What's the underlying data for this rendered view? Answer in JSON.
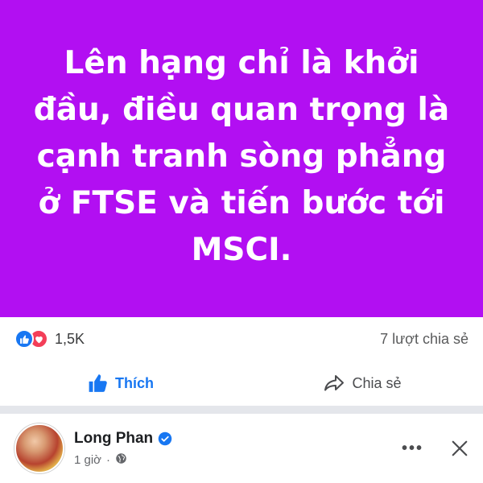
{
  "post": {
    "text": "Lên hạng chỉ là khởi đầu, điều quan trọng là cạnh tranh sòng phẳng ở FTSE và tiến bước tới MSCI.",
    "background_color": "#b20ff2"
  },
  "reactions": {
    "count": "1,5K",
    "shares": "7 lượt chia sẻ",
    "icons": [
      "like-icon",
      "love-icon"
    ]
  },
  "actions": {
    "like_label": "Thích",
    "share_label": "Chia sẻ"
  },
  "author": {
    "name": "Long Phan",
    "time": "1 giờ",
    "verified": true,
    "visibility_icon": "globe-icon"
  },
  "colors": {
    "accent": "#1877f2",
    "love": "#f33e58"
  }
}
